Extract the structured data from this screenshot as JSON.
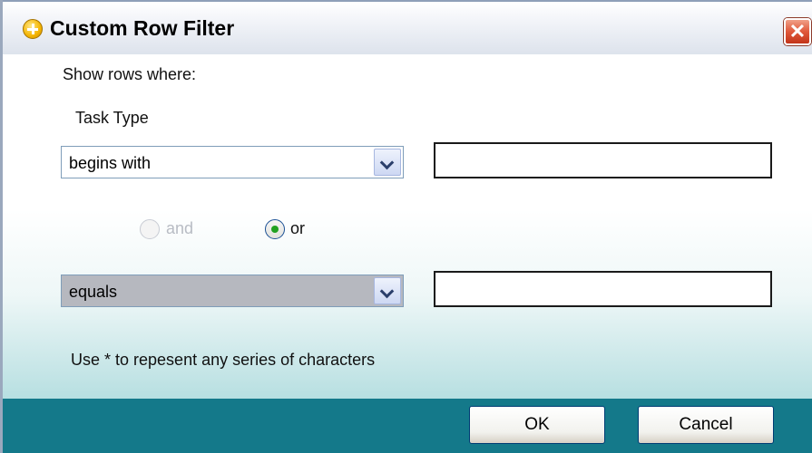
{
  "dialog": {
    "title": "Custom Row Filter",
    "close_label": "✕"
  },
  "filter": {
    "intro": "Show rows where:",
    "column_name": "Task Type",
    "condition1": {
      "operator": "begins with",
      "value": ""
    },
    "logic": {
      "and_label": "and",
      "or_label": "or",
      "selected": "or",
      "and_enabled": false
    },
    "condition2": {
      "operator": "equals",
      "value": ""
    },
    "hint": "Use * to repesent any series of characters"
  },
  "buttons": {
    "ok": "OK",
    "cancel": "Cancel"
  },
  "colors": {
    "footer": "#14798a",
    "radio_dot": "#21a121",
    "close": "#e0583a"
  }
}
